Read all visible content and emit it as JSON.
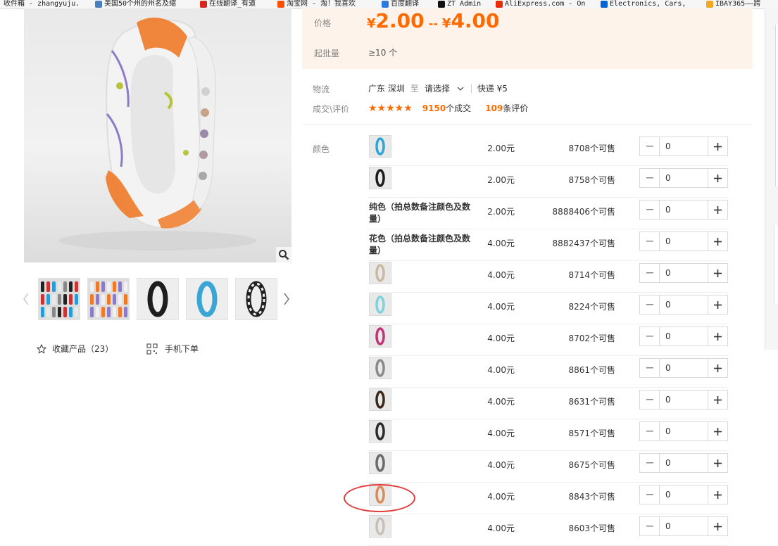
{
  "bookmarks": [
    {
      "label": "收件箱 - zhangyuju.",
      "icon": "none",
      "color": "#999999"
    },
    {
      "label": "美国50个州的州名及缩",
      "icon": "pen-icon",
      "color": "#4a7ebb"
    },
    {
      "label": "在线翻译_有道",
      "icon": "youdao-icon",
      "color": "#d9261c"
    },
    {
      "label": "淘宝网 - 淘！我喜欢",
      "icon": "taobao-icon",
      "color": "#ff5000"
    },
    {
      "label": "百度翻译",
      "icon": "baidu-translate-icon",
      "color": "#2b7bde"
    },
    {
      "label": "ZT Admin",
      "icon": "zt-admin-icon",
      "color": "#111111"
    },
    {
      "label": "AliExpress.com - On",
      "icon": "aliexpress-icon",
      "color": "#e62e04"
    },
    {
      "label": "Electronics, Cars,",
      "icon": "ebay-icon",
      "color": "#0064d2"
    },
    {
      "label": "IBAY365——跨",
      "icon": "ibay-icon",
      "color": "#f5a623"
    }
  ],
  "gallery": {
    "zoom_icon": "magnifier-icon",
    "thumbs": [
      {
        "name": "thumb-multi-color",
        "colors": [
          "#222",
          "#c33",
          "#2a9bd6",
          "#e8e8e8",
          "#888"
        ]
      },
      {
        "name": "thumb-floral-orange",
        "colors": [
          "#f0f0f0",
          "#f07a28",
          "#8c7bc6"
        ]
      },
      {
        "name": "thumb-black",
        "colors": [
          "#1d1d1d"
        ]
      },
      {
        "name": "thumb-blue",
        "colors": [
          "#3aa6d6"
        ]
      },
      {
        "name": "thumb-black-white-pattern",
        "colors": [
          "#f2f2f2",
          "#222"
        ]
      }
    ],
    "collect_label": "收藏产品（23）",
    "mobile_label": "手机下单"
  },
  "price": {
    "label": "价格",
    "currency": "¥",
    "low": "2.00",
    "dash": "--",
    "high": "4.00",
    "moq_label": "起批量",
    "moq_value": "≥10 个"
  },
  "shipping": {
    "label": "物流",
    "from": "广东 深圳",
    "to_word": "至",
    "select_text": "请选择",
    "method": "快递 ¥5"
  },
  "rating": {
    "label": "成交\\评价",
    "stars": "★★★★★",
    "deals_num": "9150",
    "deals_suffix": "个成交",
    "reviews_num": "109",
    "reviews_suffix": "条评价"
  },
  "sku": {
    "label": "颜色",
    "rows": [
      {
        "thumb": "#2fa6d8",
        "name": "",
        "price": "2.00元",
        "stock": "8708个可售",
        "qty": "0"
      },
      {
        "thumb": "#1a1a1a",
        "name": "",
        "price": "2.00元",
        "stock": "8758个可售",
        "qty": "0"
      },
      {
        "thumb": null,
        "name": "纯色（拍总数备注颜色及数量）",
        "price": "2.00元",
        "stock": "8888406个可售",
        "qty": "0"
      },
      {
        "thumb": null,
        "name": "花色（拍总数备注颜色及数量）",
        "price": "4.00元",
        "stock": "8882437个可售",
        "qty": "0"
      },
      {
        "thumb": "#c9b9a0",
        "name": "",
        "price": "4.00元",
        "stock": "8714个可售",
        "qty": "0"
      },
      {
        "thumb": "#7fd1dc",
        "name": "",
        "price": "4.00元",
        "stock": "8224个可售",
        "qty": "0"
      },
      {
        "thumb": "#c2337a",
        "name": "",
        "price": "4.00元",
        "stock": "8702个可售",
        "qty": "0"
      },
      {
        "thumb": "#8a8a8a",
        "name": "",
        "price": "4.00元",
        "stock": "8861个可售",
        "qty": "0"
      },
      {
        "thumb": "#3b2a1c",
        "name": "",
        "price": "4.00元",
        "stock": "8631个可售",
        "qty": "0"
      },
      {
        "thumb": "#2b2b2b",
        "name": "",
        "price": "4.00元",
        "stock": "8571个可售",
        "qty": "0"
      },
      {
        "thumb": "#6a6a6a",
        "name": "",
        "price": "4.00元",
        "stock": "8675个可售",
        "qty": "0"
      },
      {
        "thumb": "#d98c5a",
        "name": "",
        "price": "4.00元",
        "stock": "8843个可售",
        "qty": "0"
      },
      {
        "thumb": "#c8c0b6",
        "name": "",
        "price": "4.00元",
        "stock": "8603个可售",
        "qty": "0"
      }
    ],
    "minus": "−",
    "plus": "+"
  },
  "colors": {
    "accent": "#ff6a00",
    "price_panel_bg": "#fdf3ea",
    "annotation": "#e23b3b"
  }
}
